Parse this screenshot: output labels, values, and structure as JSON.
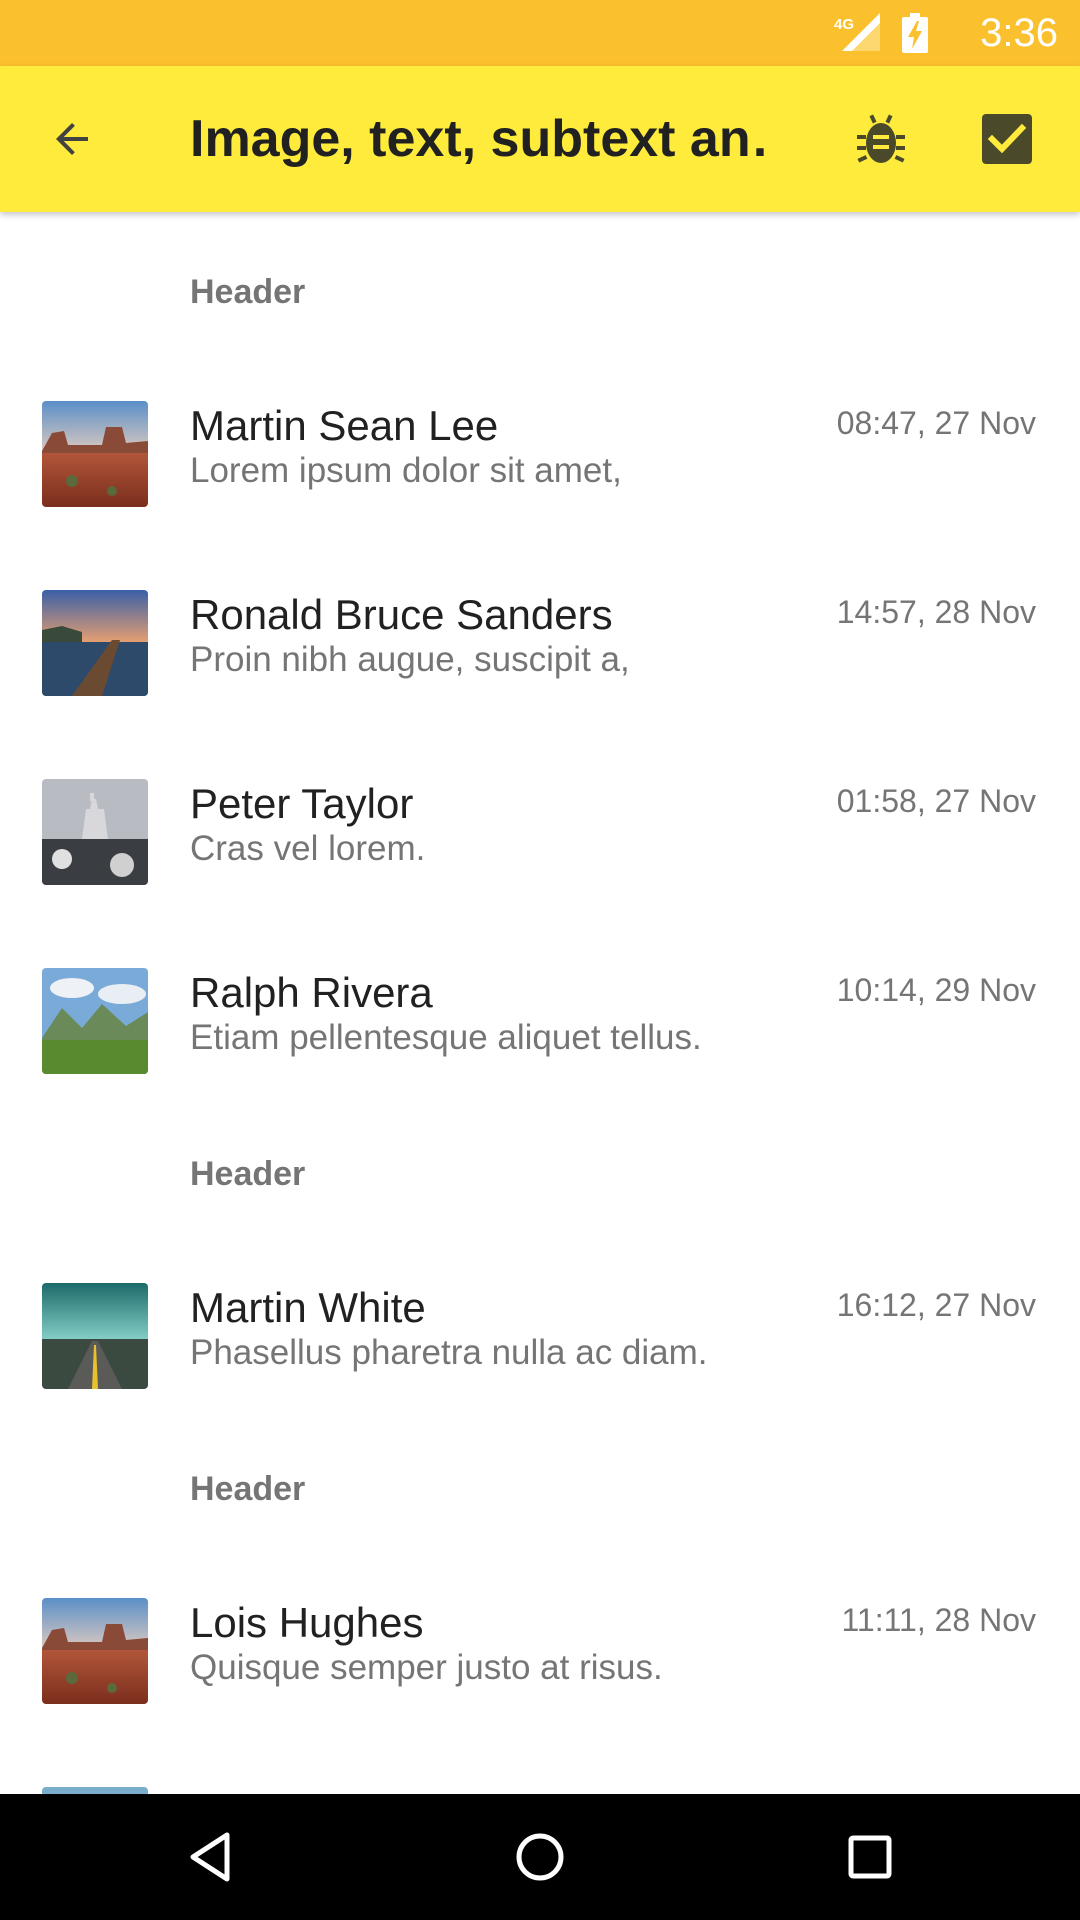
{
  "status_bar": {
    "network": "4G",
    "time": "3:36",
    "color": "#FBC02D"
  },
  "app_bar": {
    "title": "Image, text, subtext an…",
    "color": "#FFEB3B",
    "icons": [
      "arrow-back-icon",
      "bug-icon",
      "checkbox-checked-icon"
    ]
  },
  "list": {
    "headers": [
      "Header",
      "Header",
      "Header"
    ],
    "items": [
      {
        "name": "Martin Sean Lee",
        "subtext": "Lorem ipsum dolor sit amet,",
        "timestamp": "08:47, 27 Nov",
        "thumb": "desert-canyon"
      },
      {
        "name": "Ronald Bruce Sanders",
        "subtext": "Proin nibh augue, suscipit a,",
        "timestamp": "14:57, 28 Nov",
        "thumb": "pier-sunset"
      },
      {
        "name": "Peter Taylor",
        "subtext": "Cras vel lorem.",
        "timestamp": "01:58, 27 Nov",
        "thumb": "castle-winter"
      },
      {
        "name": "Ralph Rivera",
        "subtext": "Etiam pellentesque aliquet tellus.",
        "timestamp": "10:14, 29 Nov",
        "thumb": "green-valley"
      },
      {
        "name": "Martin White",
        "subtext": "Phasellus pharetra nulla ac diam.",
        "timestamp": "16:12, 27 Nov",
        "thumb": "teal-road"
      },
      {
        "name": "Lois Hughes",
        "subtext": "Quisque semper justo at risus.",
        "timestamp": "11:11, 28 Nov",
        "thumb": "desert-canyon"
      }
    ]
  },
  "nav_bar": {
    "buttons": [
      "back-triangle-icon",
      "home-circle-icon",
      "recents-square-icon"
    ]
  }
}
